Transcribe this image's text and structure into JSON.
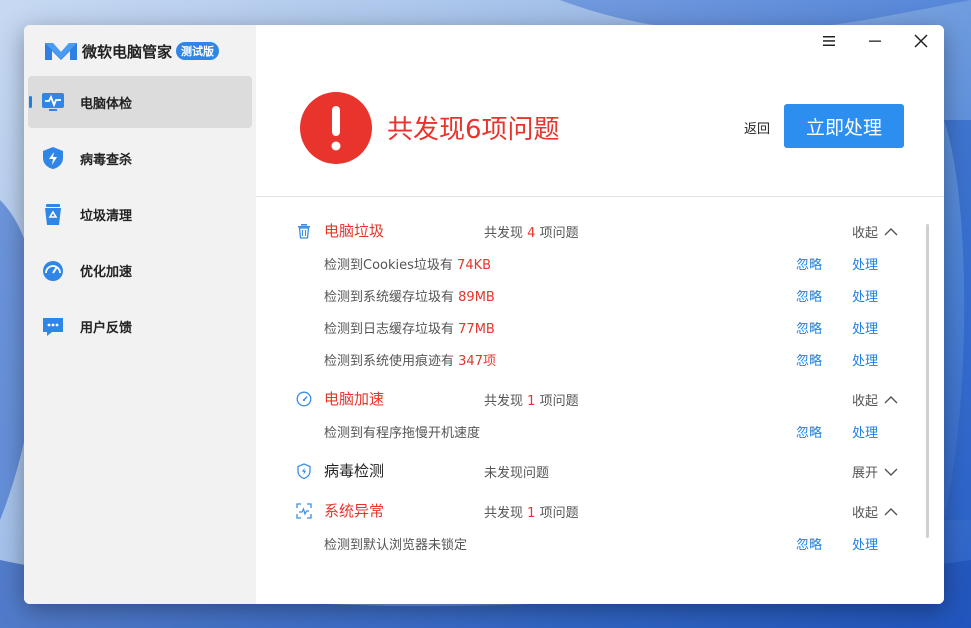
{
  "app": {
    "title": "微软电脑管家",
    "badge": "测试版",
    "accent_color": "#2c8ff0",
    "alert_color": "#e8342c"
  },
  "sidebar": {
    "items": [
      {
        "label": "电脑体检",
        "icon": "pulse-monitor-icon",
        "active": true
      },
      {
        "label": "病毒查杀",
        "icon": "shield-bolt-icon",
        "active": false
      },
      {
        "label": "垃圾清理",
        "icon": "recycle-bin-icon",
        "active": false
      },
      {
        "label": "优化加速",
        "icon": "speedometer-icon",
        "active": false
      },
      {
        "label": "用户反馈",
        "icon": "chat-bubble-icon",
        "active": false
      }
    ]
  },
  "window_controls": [
    "menu-icon",
    "minimize-icon",
    "close-icon"
  ],
  "header": {
    "headline": "共发现6项问题",
    "back_label": "返回",
    "fix_label": "立即处理"
  },
  "actions": {
    "ignore": "忽略",
    "handle": "处理"
  },
  "sections": [
    {
      "title": "电脑垃圾",
      "icon": "trash-icon",
      "summary_prefix": "共发现",
      "count": "4",
      "summary_suffix": "项问题",
      "toggle": "收起",
      "items": [
        {
          "text": "检测到Cookies垃圾有",
          "value": "74KB"
        },
        {
          "text": "检测到系统缓存垃圾有",
          "value": "89MB"
        },
        {
          "text": "检测到日志缓存垃圾有",
          "value": "77MB"
        },
        {
          "text": "检测到系统使用痕迹有",
          "value": "347项"
        }
      ]
    },
    {
      "title": "电脑加速",
      "icon": "gauge-icon",
      "summary_prefix": "共发现",
      "count": "1",
      "summary_suffix": "项问题",
      "toggle": "收起",
      "items": [
        {
          "text": "检测到有程序拖慢开机速度",
          "value": ""
        }
      ]
    },
    {
      "title": "病毒检测",
      "icon": "shield-icon",
      "summary": "未发现问题",
      "toggle": "展开",
      "items": []
    },
    {
      "title": "系统异常",
      "icon": "scan-icon",
      "summary_prefix": "共发现",
      "count": "1",
      "summary_suffix": "项问题",
      "toggle": "收起",
      "items": [
        {
          "text": "检测到默认浏览器未锁定",
          "value": ""
        }
      ]
    }
  ]
}
